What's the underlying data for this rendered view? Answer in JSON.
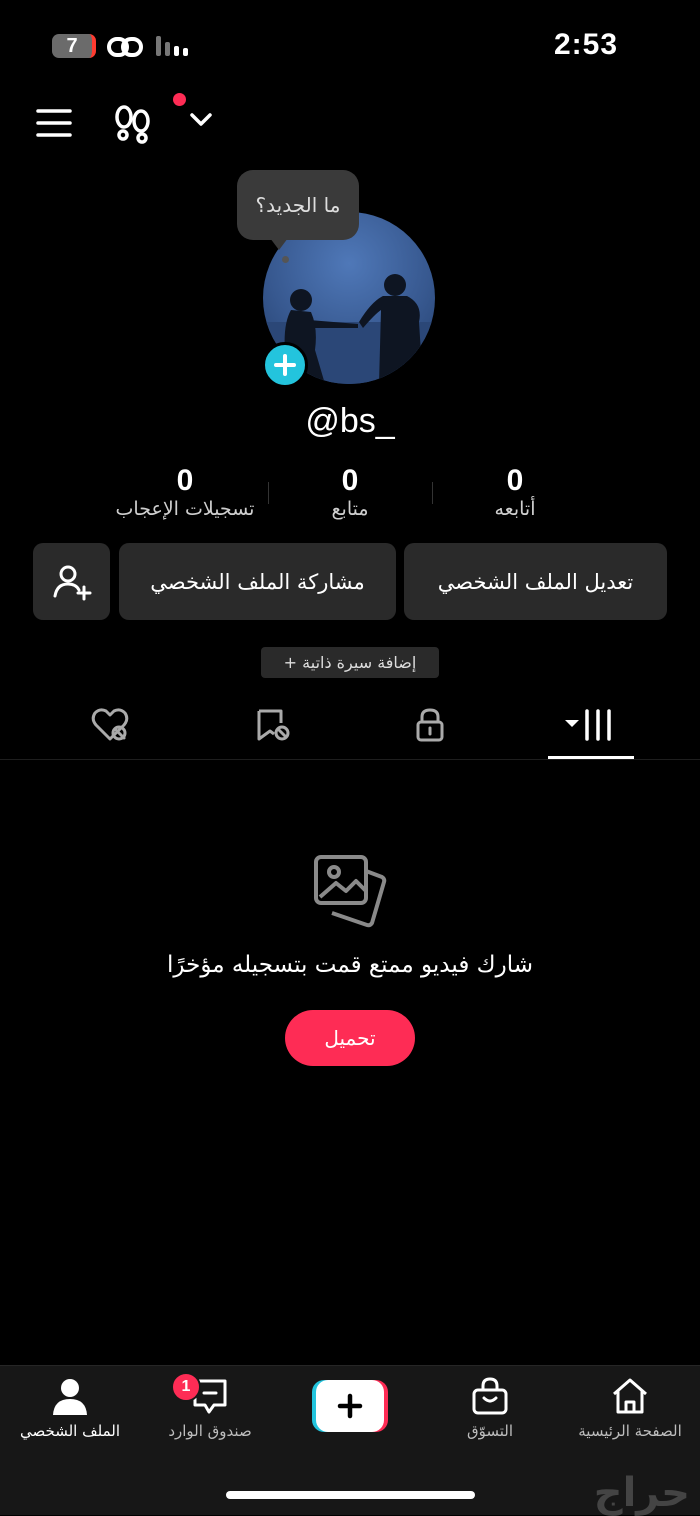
{
  "status_bar": {
    "battery": "7",
    "time": "2:53"
  },
  "header": {
    "menu_icon": "hamburger-menu-icon",
    "footprints_icon": "footprints-icon",
    "notification_dot_color": "#fe2c55"
  },
  "profile": {
    "tooltip": "ما الجديد؟",
    "username": "@bs_",
    "stats": [
      {
        "value": "0",
        "label": "تسجيلات الإعجاب"
      },
      {
        "value": "0",
        "label": "متابع"
      },
      {
        "value": "0",
        "label": "أتابعه"
      }
    ],
    "buttons": {
      "edit": "تعديل الملف الشخصي",
      "share": "مشاركة الملف الشخصي"
    },
    "bio_button": "+ إضافة سيرة ذاتية"
  },
  "tabs": [
    "videos-grid-icon",
    "lock-icon",
    "saved-icon",
    "liked-icon"
  ],
  "empty_state": {
    "title": "شارك فيديو ممتع قمت بتسجيله مؤخرًا",
    "button": "تحميل"
  },
  "bottom_nav": {
    "items": [
      {
        "label": "الملف الشخصي",
        "icon": "profile-icon",
        "active": true
      },
      {
        "label": "صندوق الوارد",
        "icon": "inbox-icon",
        "badge": "1"
      },
      {
        "label": "",
        "icon": "create-plus-icon"
      },
      {
        "label": "التسوّق",
        "icon": "shopping-bag-icon"
      },
      {
        "label": "الصفحة الرئيسية",
        "icon": "home-icon"
      }
    ]
  },
  "watermark": "حراج",
  "colors": {
    "accent": "#fe2c55",
    "cyan": "#23c4dd",
    "background": "#000000",
    "surface": "#2a2a2a"
  }
}
